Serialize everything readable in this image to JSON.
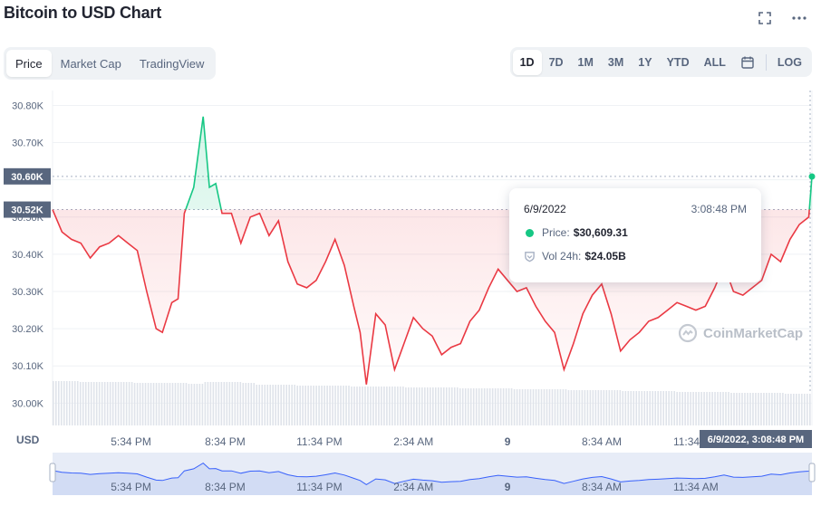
{
  "header": {
    "title": "Bitcoin to USD Chart"
  },
  "tabs_left": [
    {
      "label": "Price",
      "active": true
    },
    {
      "label": "Market Cap",
      "active": false
    },
    {
      "label": "TradingView",
      "active": false
    }
  ],
  "tabs_right": [
    {
      "label": "1D",
      "active": true
    },
    {
      "label": "7D",
      "active": false
    },
    {
      "label": "1M",
      "active": false
    },
    {
      "label": "3M",
      "active": false
    },
    {
      "label": "1Y",
      "active": false
    },
    {
      "label": "YTD",
      "active": false
    },
    {
      "label": "ALL",
      "active": false
    }
  ],
  "log_label": "LOG",
  "icons": {
    "fullscreen": "fullscreen-icon",
    "more": "more-icon",
    "calendar": "calendar-icon"
  },
  "tooltip": {
    "date": "6/9/2022",
    "time": "3:08:48 PM",
    "price_label": "Price:",
    "price_value": "$30,609.31",
    "vol_label": "Vol 24h:",
    "vol_value": "$24.05B"
  },
  "watermark": "CoinMarketCap",
  "axis": {
    "currency_label": "USD",
    "cursor_label": "6/9/2022, 3:08:48 PM",
    "current_price_tag": "30.60K",
    "open_price_tag": "30.52K"
  },
  "colors": {
    "up": "#16c784",
    "down": "#ea3943",
    "grid": "#eff2f5",
    "axis_text": "#58667e",
    "tag_bg": "#58667e"
  },
  "chart_data": {
    "type": "line",
    "ylim": [
      29940,
      30840
    ],
    "y_ticks": [
      30000,
      30100,
      30200,
      30300,
      30400,
      30500,
      30600,
      30700,
      30800
    ],
    "y_tick_labels": [
      "30.00K",
      "30.10K",
      "30.20K",
      "30.30K",
      "30.40K",
      "30.50K",
      "30.60K",
      "30.70K",
      "30.80K"
    ],
    "x_ticks": [
      "5:34 PM",
      "8:34 PM",
      "11:34 PM",
      "2:34 AM",
      "9",
      "8:34 AM",
      "11:34 AM"
    ],
    "x_range": [
      0,
      24.2
    ],
    "x_tick_positions": [
      2.5,
      5.5,
      8.5,
      11.5,
      14.5,
      17.5,
      20.5
    ],
    "open_price": 30520,
    "current_price": 30609.31,
    "x": [
      0,
      0.3,
      0.6,
      0.9,
      1.2,
      1.5,
      1.8,
      2.1,
      2.4,
      2.7,
      3,
      3.3,
      3.5,
      3.8,
      4.0,
      4.2,
      4.5,
      4.8,
      5.0,
      5.2,
      5.4,
      5.7,
      6.0,
      6.3,
      6.6,
      6.9,
      7.2,
      7.5,
      7.8,
      8.1,
      8.4,
      8.7,
      9.0,
      9.3,
      9.6,
      9.8,
      10.0,
      10.3,
      10.6,
      10.9,
      11.2,
      11.5,
      11.8,
      12.1,
      12.4,
      12.7,
      13.0,
      13.3,
      13.6,
      13.9,
      14.2,
      14.5,
      14.8,
      15.1,
      15.4,
      15.7,
      16.0,
      16.3,
      16.6,
      16.9,
      17.2,
      17.5,
      17.8,
      18.1,
      18.4,
      18.7,
      19.0,
      19.3,
      19.6,
      19.9,
      20.2,
      20.5,
      20.8,
      21.1,
      21.4,
      21.7,
      22.0,
      22.3,
      22.6,
      22.9,
      23.2,
      23.5,
      23.8,
      24.1,
      24.2
    ],
    "y": [
      30520,
      30460,
      30440,
      30430,
      30390,
      30420,
      30430,
      30450,
      30430,
      30410,
      30300,
      30200,
      30190,
      30270,
      30280,
      30510,
      30580,
      30770,
      30580,
      30590,
      30510,
      30510,
      30430,
      30500,
      30510,
      30450,
      30490,
      30380,
      30320,
      30310,
      30330,
      30380,
      30440,
      30370,
      30260,
      30190,
      30050,
      30240,
      30210,
      30090,
      30160,
      30230,
      30200,
      30180,
      30130,
      30150,
      30160,
      30220,
      30250,
      30310,
      30360,
      30330,
      30300,
      30310,
      30260,
      30220,
      30190,
      30090,
      30160,
      30240,
      30290,
      30320,
      30240,
      30140,
      30170,
      30190,
      30220,
      30230,
      30250,
      30270,
      30260,
      30250,
      30260,
      30310,
      30370,
      30300,
      30290,
      30310,
      30330,
      30400,
      30380,
      30440,
      30480,
      30500,
      30609
    ]
  }
}
